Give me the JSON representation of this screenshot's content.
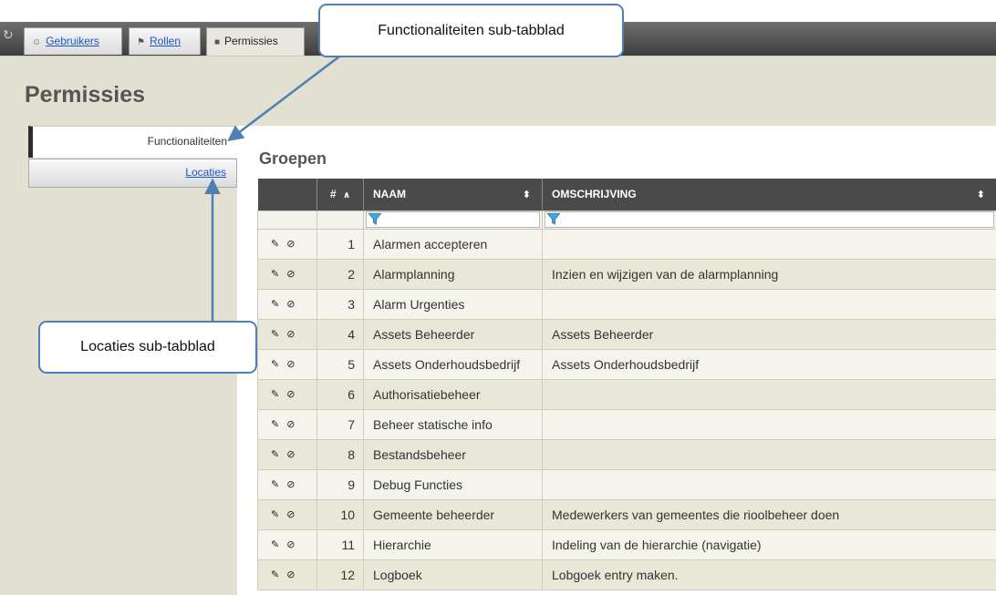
{
  "tabs": [
    {
      "label": "Gebruikers",
      "icon": "user-icon",
      "active": false
    },
    {
      "label": "Rollen",
      "icon": "roles-icon",
      "active": false
    },
    {
      "label": "Permissies",
      "icon": "permissions-icon",
      "active": true
    }
  ],
  "page_title": "Permissies",
  "subtabs": {
    "functionaliteiten": "Functionaliteiten",
    "locaties": "Locaties"
  },
  "section_title": "Groepen",
  "table": {
    "columns": {
      "num": "#",
      "name": "NAAM",
      "description": "OMSCHRIJVING"
    },
    "rows": [
      {
        "nr": "1",
        "naam": "Alarmen accepteren",
        "omschrijving": ""
      },
      {
        "nr": "2",
        "naam": "Alarmplanning",
        "omschrijving": "Inzien en wijzigen van de alarmplanning"
      },
      {
        "nr": "3",
        "naam": "Alarm Urgenties",
        "omschrijving": ""
      },
      {
        "nr": "4",
        "naam": "Assets Beheerder",
        "omschrijving": "Assets Beheerder"
      },
      {
        "nr": "5",
        "naam": "Assets Onderhoudsbedrijf",
        "omschrijving": "Assets Onderhoudsbedrijf"
      },
      {
        "nr": "6",
        "naam": "Authorisatiebeheer",
        "omschrijving": ""
      },
      {
        "nr": "7",
        "naam": "Beheer statische info",
        "omschrijving": ""
      },
      {
        "nr": "8",
        "naam": "Bestandsbeheer",
        "omschrijving": ""
      },
      {
        "nr": "9",
        "naam": "Debug Functies",
        "omschrijving": ""
      },
      {
        "nr": "10",
        "naam": "Gemeente beheerder",
        "omschrijving": "Medewerkers van gemeentes die rioolbeheer doen"
      },
      {
        "nr": "11",
        "naam": "Hierarchie",
        "omschrijving": "Indeling van de hierarchie (navigatie)"
      },
      {
        "nr": "12",
        "naam": "Logboek",
        "omschrijving": "Lobgoek entry maken."
      }
    ]
  },
  "callouts": {
    "functionaliteiten": "Functionaliteiten sub-tabblad",
    "locaties": "Locaties sub-tabblad"
  },
  "colors": {
    "accent": "#4f7fb5",
    "header_bg": "#4a4a4a",
    "panel_bg": "#e2e0d1",
    "link": "#1a55c9"
  }
}
